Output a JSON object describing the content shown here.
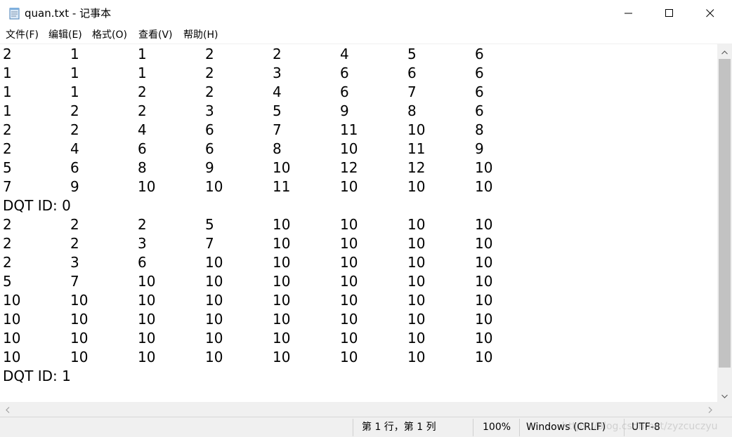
{
  "window": {
    "title": "quan.txt - 记事本"
  },
  "icons": {
    "app": "notepad-icon",
    "minimize": "minimize-icon",
    "maximize": "maximize-icon",
    "close": "close-icon",
    "scroll_up": "scroll-up-arrow-icon",
    "scroll_down": "scroll-down-arrow-icon",
    "scroll_left": "scroll-left-arrow-icon",
    "scroll_right": "scroll-right-arrow-icon"
  },
  "menu": {
    "items": [
      "文件(F)",
      "编辑(E)",
      "格式(O)",
      "查看(V)",
      "帮助(H)"
    ]
  },
  "content": {
    "table1": [
      [
        "2",
        "1",
        "1",
        "2",
        "2",
        "4",
        "5",
        "6"
      ],
      [
        "1",
        "1",
        "1",
        "2",
        "3",
        "6",
        "6",
        "6"
      ],
      [
        "1",
        "1",
        "2",
        "2",
        "4",
        "6",
        "7",
        "6"
      ],
      [
        "1",
        "2",
        "2",
        "3",
        "5",
        "9",
        "8",
        "6"
      ],
      [
        "2",
        "2",
        "4",
        "6",
        "7",
        "11",
        "10",
        "8"
      ],
      [
        "2",
        "4",
        "6",
        "6",
        "8",
        "10",
        "11",
        "9"
      ],
      [
        "5",
        "6",
        "8",
        "9",
        "10",
        "12",
        "12",
        "10"
      ],
      [
        "7",
        "9",
        "10",
        "10",
        "11",
        "10",
        "10",
        "10"
      ]
    ],
    "label1": "DQT ID: 0",
    "table2": [
      [
        "2",
        "2",
        "2",
        "5",
        "10",
        "10",
        "10",
        "10"
      ],
      [
        "2",
        "2",
        "3",
        "7",
        "10",
        "10",
        "10",
        "10"
      ],
      [
        "2",
        "3",
        "6",
        "10",
        "10",
        "10",
        "10",
        "10"
      ],
      [
        "5",
        "7",
        "10",
        "10",
        "10",
        "10",
        "10",
        "10"
      ],
      [
        "10",
        "10",
        "10",
        "10",
        "10",
        "10",
        "10",
        "10"
      ],
      [
        "10",
        "10",
        "10",
        "10",
        "10",
        "10",
        "10",
        "10"
      ],
      [
        "10",
        "10",
        "10",
        "10",
        "10",
        "10",
        "10",
        "10"
      ],
      [
        "10",
        "10",
        "10",
        "10",
        "10",
        "10",
        "10",
        "10"
      ]
    ],
    "label2": "DQT ID: 1"
  },
  "status": {
    "position": "第 1 行，第 1 列",
    "zoom": "100%",
    "line_ending": "Windows (CRLF)",
    "encoding": "UTF-8"
  },
  "watermark": "https://blog.csdn.net/zyzcuczyu",
  "colors": {
    "window_bg": "#ffffff",
    "chrome_bg": "#f0f0f0",
    "scroll_thumb": "#c2c2c2",
    "text": "#000000"
  }
}
